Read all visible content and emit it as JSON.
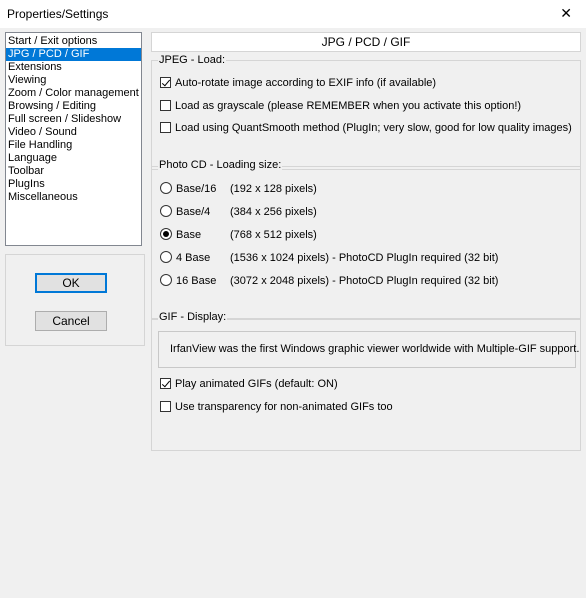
{
  "window": {
    "title": "Properties/Settings",
    "close_glyph": "✕"
  },
  "categories": [
    "Start / Exit options",
    "JPG / PCD / GIF",
    "Extensions",
    "Viewing",
    "Zoom / Color management",
    "Browsing / Editing",
    "Full screen / Slideshow",
    "Video / Sound",
    "File Handling",
    "Language",
    "Toolbar",
    "PlugIns",
    "Miscellaneous"
  ],
  "selected_category": "JPG / PCD / GIF",
  "buttons": {
    "ok": "OK",
    "cancel": "Cancel"
  },
  "panel": {
    "header": "JPG / PCD / GIF",
    "jpeg": {
      "label": "JPEG - Load:",
      "options": [
        {
          "label": "Auto-rotate image according to EXIF info (if available)",
          "checked": true
        },
        {
          "label": "Load as grayscale (please REMEMBER when you activate this option!)",
          "checked": false
        },
        {
          "label": "Load using QuantSmooth method (PlugIn; very slow, good for low quality images)",
          "checked": false
        }
      ]
    },
    "pcd": {
      "label": "Photo CD - Loading size:",
      "options": [
        {
          "name": "Base/16",
          "desc": "(192 x 128 pixels)",
          "selected": false
        },
        {
          "name": "Base/4",
          "desc": "(384 x 256 pixels)",
          "selected": false
        },
        {
          "name": "Base",
          "desc": "(768 x 512 pixels)",
          "selected": true
        },
        {
          "name": "4 Base",
          "desc": "(1536 x 1024 pixels) - PhotoCD PlugIn required (32 bit)",
          "selected": false
        },
        {
          "name": "16 Base",
          "desc": "(3072 x 2048 pixels) - PhotoCD PlugIn required (32 bit)",
          "selected": false
        }
      ]
    },
    "gif": {
      "label": "GIF - Display:",
      "info": "IrfanView was the first Windows graphic viewer worldwide with Multiple-GIF support.",
      "options": [
        {
          "label": "Play animated GIFs (default: ON)",
          "checked": true
        },
        {
          "label": "Use transparency for non-animated GIFs too",
          "checked": false
        }
      ]
    }
  },
  "colors": {
    "selection": "#0078d7",
    "dialog_bg": "#f0f0f0"
  }
}
